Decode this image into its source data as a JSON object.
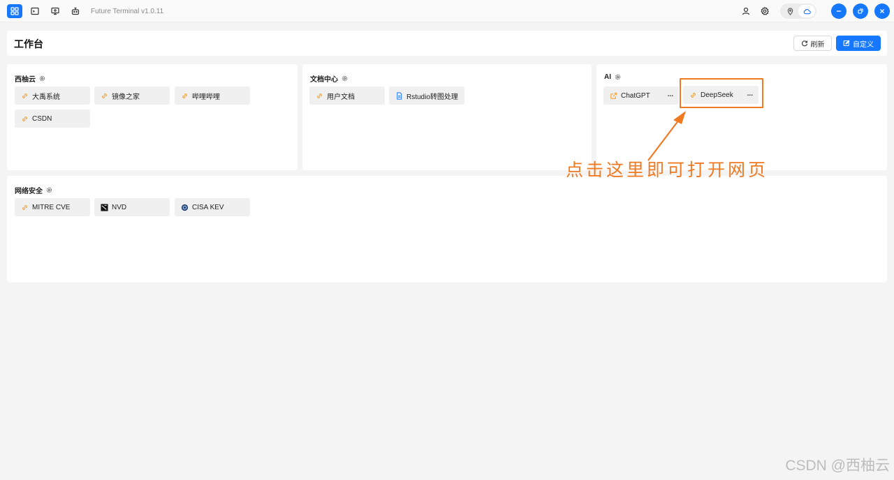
{
  "app": {
    "title": "Future Terminal v1.0.11"
  },
  "titlebar": {
    "left_icons": [
      "grid-icon",
      "terminal-icon",
      "monitor-icon",
      "robot-icon"
    ],
    "right_icons": [
      "user-icon",
      "gear-icon"
    ],
    "toggle": [
      "location-icon",
      "cloud-icon"
    ],
    "window_controls": [
      "minimize-icon",
      "restore-icon",
      "close-icon"
    ]
  },
  "header": {
    "title": "工作台",
    "refresh_label": "刷新",
    "custom_label": "自定义"
  },
  "groups": {
    "xiyouyun": {
      "title": "西柚云",
      "items": [
        "大禹系统",
        "镜像之家",
        "哔哩哔哩",
        "CSDN"
      ]
    },
    "docs": {
      "title": "文档中心",
      "items": [
        "用户文档",
        "Rstudio转图处理"
      ]
    },
    "ai": {
      "title": "AI",
      "items": [
        "ChatGPT",
        "DeepSeek"
      ],
      "more": "..."
    },
    "security": {
      "title": "网络安全",
      "items": [
        "MITRE CVE",
        "NVD",
        "CISA KEV"
      ]
    }
  },
  "annotation": {
    "text": "点击这里即可打开网页"
  },
  "watermark": "CSDN @西柚云",
  "colors": {
    "accent": "#1677ff",
    "annotation": "#f07a22",
    "link_icon": "#f0a33a"
  }
}
